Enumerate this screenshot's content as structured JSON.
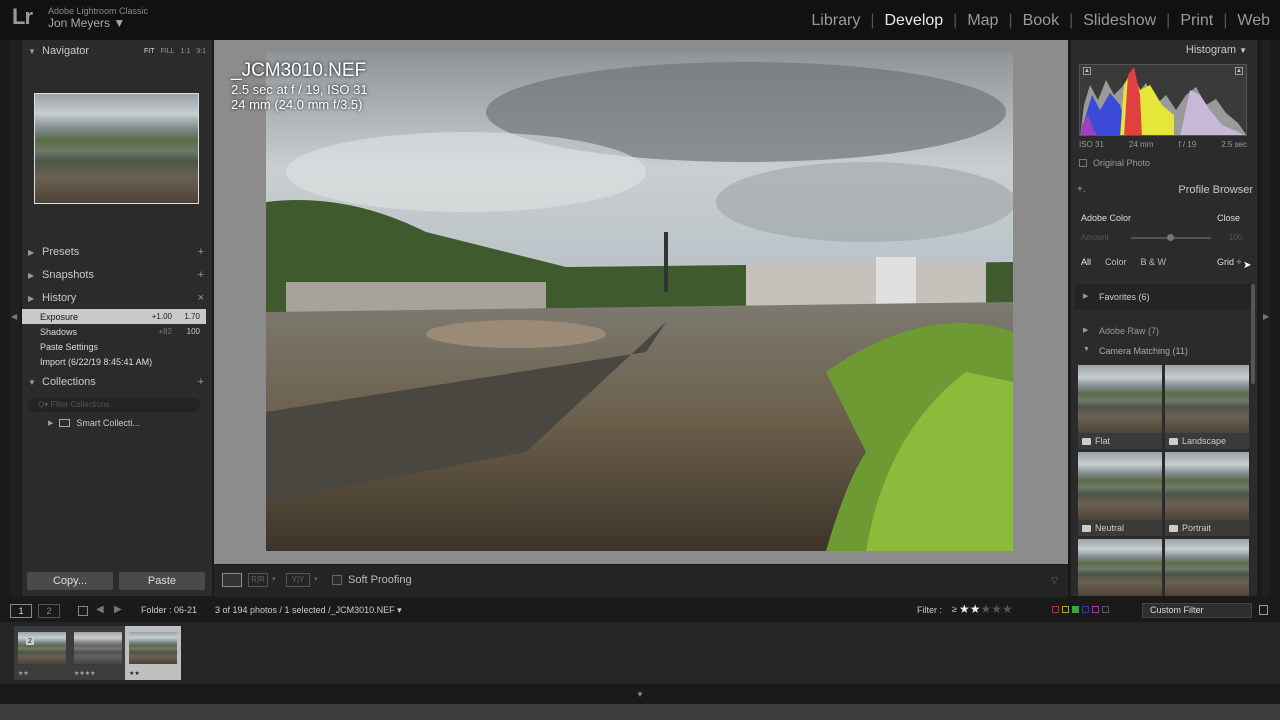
{
  "app": {
    "logo": "Lr",
    "name": "Adobe Lightroom Classic",
    "user": "Jon Meyers ▼"
  },
  "modules": [
    "Library",
    "Develop",
    "Map",
    "Book",
    "Slideshow",
    "Print",
    "Web"
  ],
  "active_module": "Develop",
  "left_panel": {
    "navigator": {
      "title": "Navigator",
      "zoom": [
        "FIT",
        "FILL",
        "1:1",
        "3:1"
      ]
    },
    "presets": "Presets",
    "snapshots": "Snapshots",
    "history": {
      "title": "History",
      "items": [
        {
          "label": "Exposure",
          "v1": "+1.00",
          "v2": "1.70"
        },
        {
          "label": "Shadows",
          "v1": "+82",
          "v2": "100"
        },
        {
          "label": "Paste Settings",
          "v1": "",
          "v2": ""
        },
        {
          "label": "Import (6/22/19 8:45:41 AM)",
          "v1": "",
          "v2": ""
        }
      ]
    },
    "collections": {
      "title": "Collections",
      "filter_placeholder": "Q▾ Filter Collections",
      "smart": "Smart Collecti..."
    },
    "copy": "Copy...",
    "paste": "Paste"
  },
  "photo_info": {
    "filename": "_JCM3010.NEF",
    "exposure": "2.5 sec at f / 19, ISO 31",
    "lens": "24 mm (24.0 mm f/3.5)"
  },
  "toolbar": {
    "ba_label": "R|R",
    "yy_label": "Y|Y",
    "soft_proofing": "Soft Proofing"
  },
  "right_panel": {
    "histogram": {
      "title": "Histogram",
      "exif": [
        "ISO 31",
        "24 mm",
        "f / 19",
        "2.5 sec"
      ],
      "original_photo": "Original Photo"
    },
    "profile_browser": {
      "title": "Profile Browser",
      "profile": "Adobe Color",
      "close": "Close",
      "amount_label": "Amount",
      "amount_value": "100",
      "filters": [
        "All",
        "Color",
        "B & W"
      ],
      "view": "Grid ÷",
      "groups": {
        "favorites": "Favorites (6)",
        "adobe_raw": "Adobe Raw (7)",
        "camera_matching": "Camera Matching (11)"
      },
      "thumbs": [
        "Flat",
        "Landscape",
        "Neutral",
        "Portrait"
      ]
    }
  },
  "filmbar": {
    "view1": "1",
    "view2": "2",
    "folder": "Folder : 06-21",
    "count": "3 of 194 photos / 1 selected /_JCM3010.NEF ▾",
    "filter_label": "Filter :",
    "filter_op": "≥",
    "stars_on": 2,
    "stars_total": 5,
    "custom_filter": "Custom Filter"
  },
  "filmstrip": [
    {
      "badge": "2",
      "stars": "★★"
    },
    {
      "badge": "",
      "stars": "★★★★"
    },
    {
      "badge": "",
      "stars": "★★",
      "selected": true
    }
  ]
}
